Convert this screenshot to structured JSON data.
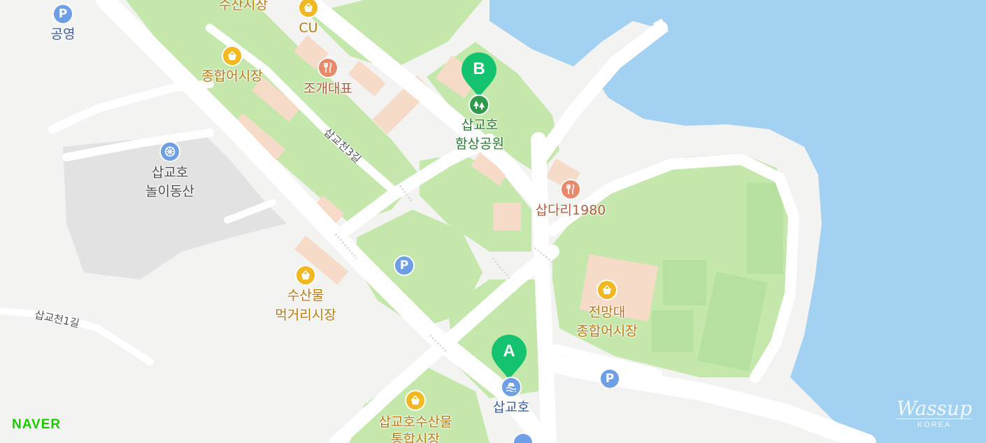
{
  "map": {
    "colors": {
      "water": "#a3d1f2",
      "land": "#f3f3f1",
      "park": "#c4e7ac",
      "park_dark": "#b5e0a0",
      "road": "#ffffff",
      "building": "#f6dcc8",
      "amusement": "#e2e2e2",
      "marker": "#15c36f"
    },
    "markers": [
      {
        "letter": "A",
        "name": "marker-a"
      },
      {
        "letter": "B",
        "name": "marker-b"
      }
    ],
    "places": {
      "susan_sijang_top": "수산시장",
      "cu": "CU",
      "gongyeong": "공영",
      "jonghap_eosijang_1": "종합어시장",
      "jogae_daepyo": "조개대표",
      "park_name_line1": "삽교호",
      "park_name_line2": "함상공원",
      "nori_line1": "삽교호",
      "nori_line2": "놀이동산",
      "sapdari": "삽다리1980",
      "mukgeori_line1": "수산물",
      "mukgeori_line2": "먹거리시장",
      "jeonmangdae_line1": "전망대",
      "jeonmangdae_line2": "종합어시장",
      "sapgyoho": "삽교호",
      "bottom_market_line1": "삽교호수산물",
      "bottom_market_line2": "통합시장"
    },
    "roads": {
      "road_3gil": "삽교천3길",
      "road_1gil": "삽교천1길"
    },
    "icons": {
      "market": "market-basket-icon",
      "food": "fork-knife-icon",
      "park": "park-trees-icon",
      "parking": "parking-icon",
      "parking_letter": "P",
      "ride": "ferris-wheel-icon",
      "water": "waterfront-icon"
    }
  },
  "branding": {
    "naver": "NAVER",
    "watermark_script": "Wassup",
    "watermark_sub": "KOREA"
  }
}
